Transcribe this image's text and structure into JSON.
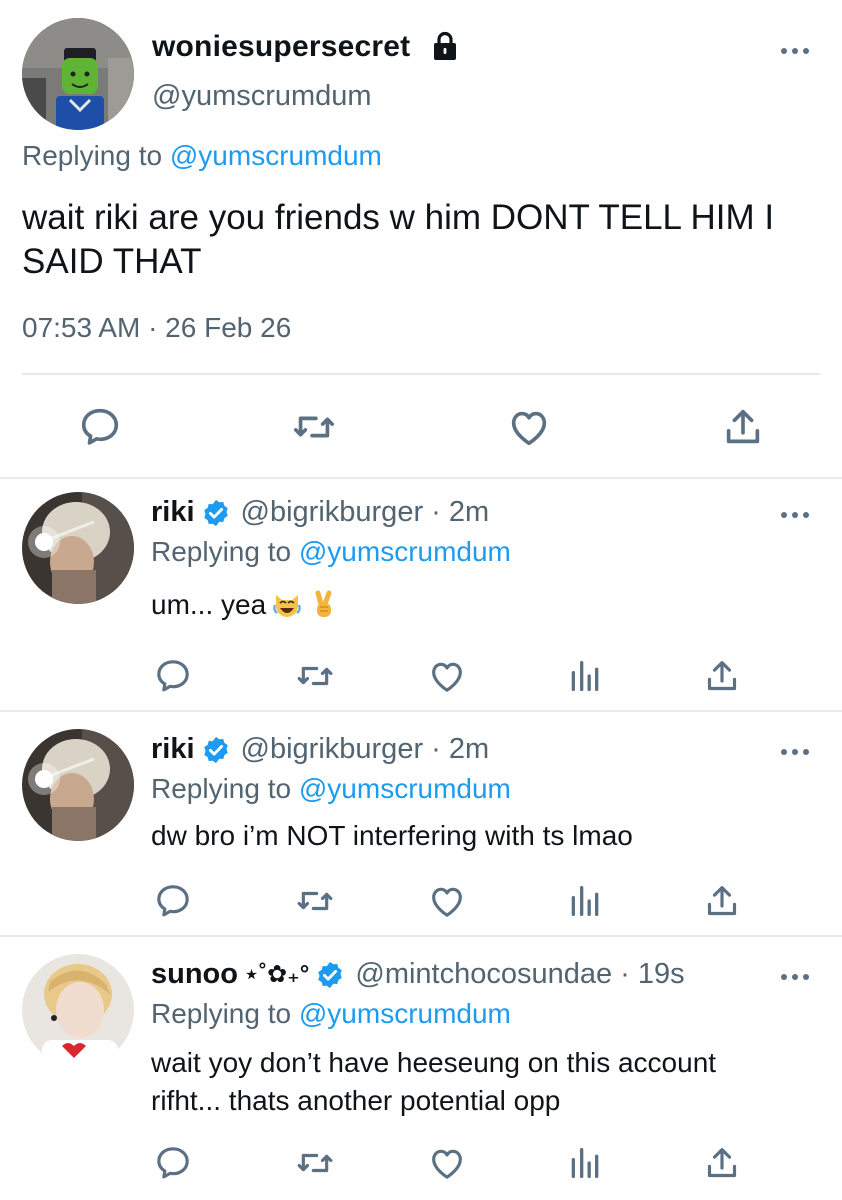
{
  "main_tweet": {
    "display_name": "woniesupersecret",
    "handle": "@yumscrumdum",
    "replying_prefix": "Replying to",
    "replying_to": "@yumscrumdum",
    "text": "wait riki are you friends w him DONT TELL HIM I SAID THAT",
    "timestamp": "07:53 AM · 26 Feb 26",
    "icons": [
      "lock-icon",
      "more-icon",
      "reply-icon",
      "retweet-icon",
      "like-icon",
      "share-icon"
    ]
  },
  "replies": [
    {
      "display_name": "riki",
      "verified": true,
      "handle": "@bigrikburger",
      "time": "· 2m",
      "replying_prefix": "Replying to",
      "replying_to": "@yumscrumdum",
      "text": "um... yea",
      "emojis": [
        "laughing-cat-emoji",
        "victory-hand-emoji"
      ]
    },
    {
      "display_name": "riki",
      "verified": true,
      "handle": "@bigrikburger",
      "time": "· 2m",
      "replying_prefix": "Replying to",
      "replying_to": "@yumscrumdum",
      "text": "dw bro i’m NOT interfering with ts lmao"
    },
    {
      "display_name": "sunoo",
      "name_decoration": "⋆˚✿₊°",
      "verified": true,
      "handle": "@mintchocosundae",
      "time": "· 19s",
      "replying_prefix": "Replying to",
      "replying_to": "@yumscrumdum",
      "text_line1": "wait yoy don’t have heeseung on this account",
      "text_line2": "rifht... thats another potential opp"
    }
  ],
  "colors": {
    "accent": "#1d9bf0",
    "secondary_text": "#536471",
    "icon": "#5b7083",
    "divider": "#e6e8ea"
  }
}
